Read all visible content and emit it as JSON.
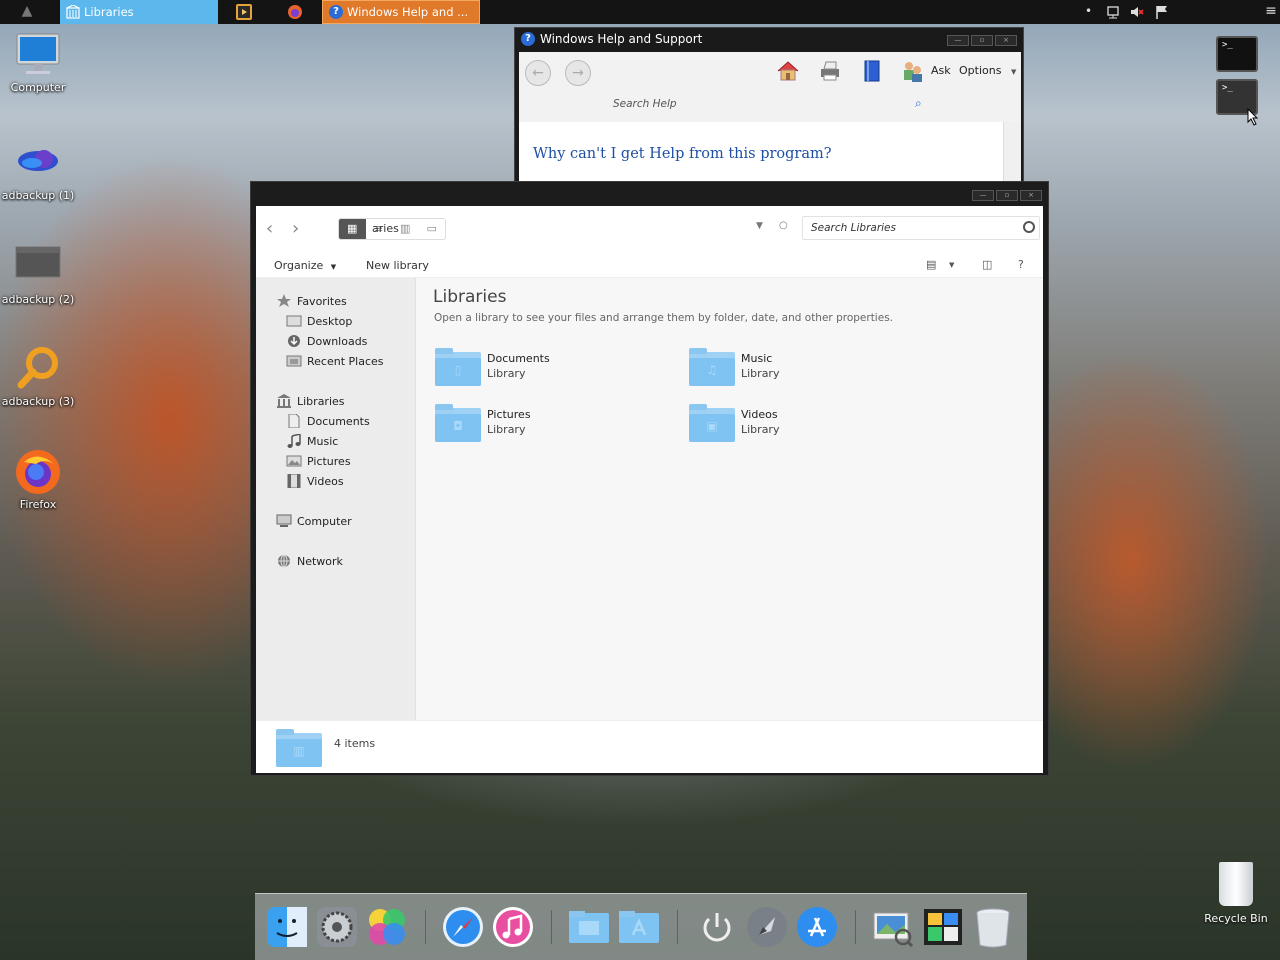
{
  "taskbar": {
    "tasks": [
      {
        "label": "Libraries",
        "icon": "library-icon"
      },
      {
        "label": "Windows Help and ...",
        "icon": "help-icon"
      }
    ],
    "quick_launch": [
      "media-player-icon",
      "firefox-icon"
    ],
    "tray_icons": [
      "dot-icon",
      "network-icon",
      "volume-muted-icon",
      "flag-icon"
    ]
  },
  "desktop": {
    "icons": [
      {
        "label": "Computer",
        "icon": "monitor-icon"
      },
      {
        "label": "adbackup (1)",
        "icon": "app-icon"
      },
      {
        "label": "adbackup (2)",
        "icon": "drive-icon"
      },
      {
        "label": "adbackup (3)",
        "icon": "magnifier-icon"
      },
      {
        "label": "Firefox",
        "icon": "firefox-icon"
      }
    ],
    "recycle_bin": "Recycle Bin"
  },
  "help_window": {
    "title": "Windows Help and Support",
    "ask_label": "Ask",
    "options_label": "Options",
    "search_placeholder": "Search Help",
    "question": "Why can't I get Help from this program?"
  },
  "explorer": {
    "crumb_partial": "aries",
    "search_placeholder": "Search Libraries",
    "organize_label": "Organize",
    "new_library_label": "New library",
    "help_label": "?",
    "sidebar": {
      "favorites": {
        "label": "Favorites",
        "items": [
          "Desktop",
          "Downloads",
          "Recent Places"
        ]
      },
      "libraries": {
        "label": "Libraries",
        "items": [
          "Documents",
          "Music",
          "Pictures",
          "Videos"
        ]
      },
      "computer": "Computer",
      "network": "Network"
    },
    "heading": "Libraries",
    "subheading": "Open a library to see your files and arrange them by folder, date, and other properties.",
    "libraries": [
      {
        "name": "Documents",
        "kind": "Library",
        "glyph": "document-icon"
      },
      {
        "name": "Music",
        "kind": "Library",
        "glyph": "music-icon"
      },
      {
        "name": "Pictures",
        "kind": "Library",
        "glyph": "camera-icon"
      },
      {
        "name": "Videos",
        "kind": "Library",
        "glyph": "film-icon"
      }
    ],
    "status": "4 items"
  },
  "widgets": {
    "terminal_prompt": ">_"
  },
  "dock": {
    "apps": [
      "finder-icon",
      "system-preferences-icon",
      "game-center-icon",
      "safari-icon",
      "itunes-icon",
      "documents-folder-icon",
      "applications-folder-icon",
      "power-icon",
      "launchpad-icon",
      "app-store-icon",
      "preview-icon",
      "photo-booth-icon",
      "trash-icon"
    ]
  },
  "colors": {
    "taskbar_bg": "#141414",
    "active_task": "#5bb7ec",
    "help_task": "#e07a2a",
    "folder_blue": "#7fc3f2",
    "link_blue": "#1d4fa6"
  }
}
